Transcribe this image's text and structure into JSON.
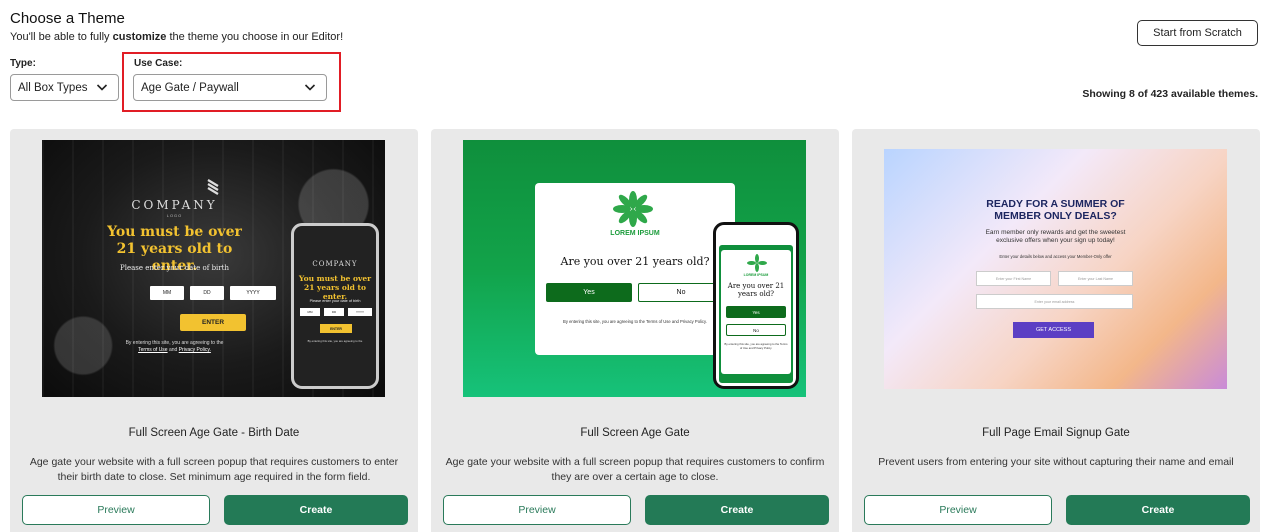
{
  "header": {
    "title": "Choose a Theme",
    "subtitle_before": "You'll be able to fully ",
    "subtitle_bold": "customize",
    "subtitle_after": " the theme you choose in our Editor!",
    "start_button": "Start from Scratch"
  },
  "filters": {
    "type_label": "Type:",
    "type_value": "All Box Types",
    "use_case_label": "Use Case:",
    "use_case_value": "Age Gate / Paywall",
    "highlight_color": "#e11d25"
  },
  "showing_text": "Showing 8 of 423 available themes.",
  "colors": {
    "create_bg": "#237a56",
    "preview_border": "#2a7a5a",
    "card_bg": "#e9e9e9"
  },
  "cards": [
    {
      "title": "Full Screen Age Gate - Birth Date",
      "description": "Age gate your website with a full screen popup that requires customers to enter their birth date to close. Set minimum age required in the form field.",
      "preview_label": "Preview",
      "create_label": "Create",
      "thumb": {
        "logo": "COMPANY",
        "logo_sub": "LOGO",
        "headline": "You must be over 21 years old to enter.",
        "prompt": "Please enter your date of birth",
        "mm": "MM",
        "dd": "DD",
        "yyyy": "YYYY",
        "enter": "ENTER",
        "legal_before": "By entering this site, you are agreeing to the",
        "legal_terms": "Terms of Use",
        "legal_and": "and",
        "legal_privacy": "Privacy Policy."
      }
    },
    {
      "title": "Full Screen Age Gate",
      "description": "Age gate your website with a full screen popup that requires customers to confirm they are over a certain age to close.",
      "preview_label": "Preview",
      "create_label": "Create",
      "thumb": {
        "brand": "LOREM IPSUM",
        "question": "Are you over 21 years old?",
        "yes": "Yes",
        "no": "No",
        "legal": "By entering this site, you are agreeing to the Terms of Use and Privacy Policy.",
        "phone_brand": "LOREM IPSUM",
        "phone_question": "Are you over 21 years old?",
        "phone_legal": "By entering this site, you are agreeing to the Terms of Use and Privacy Policy."
      }
    },
    {
      "title": "Full Page Email Signup Gate",
      "description": "Prevent users from entering your site without capturing their name and email",
      "preview_label": "Preview",
      "create_label": "Create",
      "thumb": {
        "headline": "READY FOR A SUMMER OF MEMBER ONLY DEALS?",
        "sub": "Earn member only rewards and get the sweetest exclusive offers when your sign up today!",
        "sub2": "Enter your details below and access your Member-Only offer",
        "first_name": "Enter your First Name",
        "last_name": "Enter your Last Name",
        "email": "Enter your email address",
        "cta": "GET ACCESS"
      }
    }
  ]
}
